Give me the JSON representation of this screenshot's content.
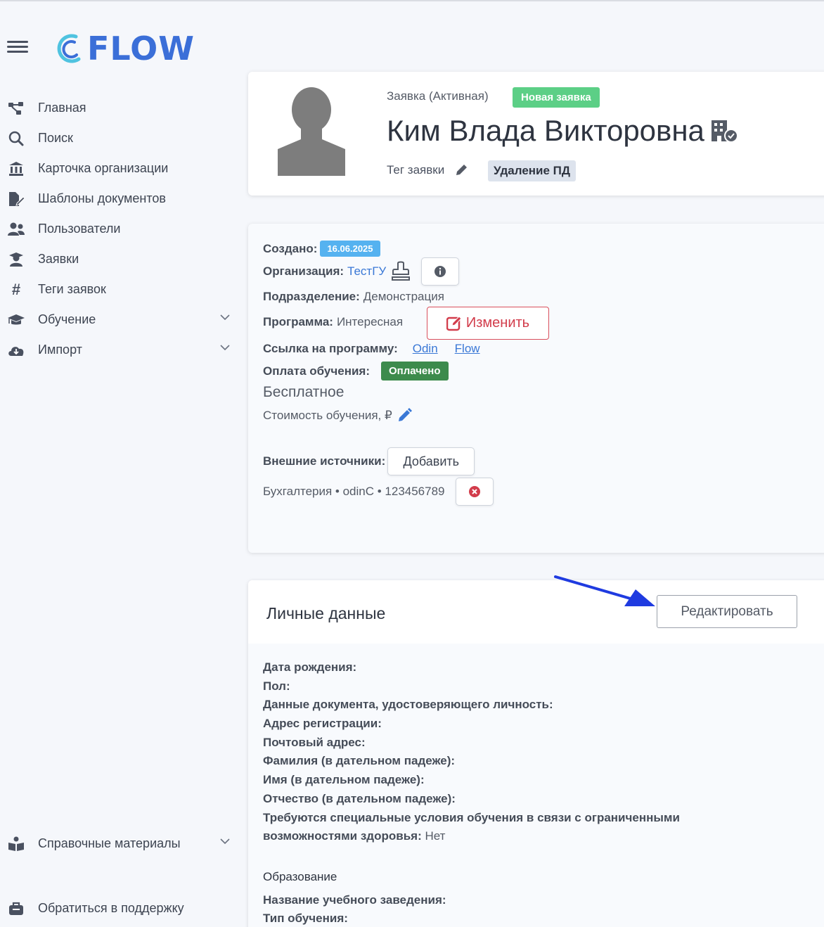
{
  "brand": {
    "name": "FLOW"
  },
  "sidebar": {
    "items": [
      {
        "label": "Главная",
        "icon": "share-nodes-icon"
      },
      {
        "label": "Поиск",
        "icon": "search-icon"
      },
      {
        "label": "Карточка организации",
        "icon": "bank-icon"
      },
      {
        "label": "Шаблоны документов",
        "icon": "file-edit-icon"
      },
      {
        "label": "Пользователи",
        "icon": "users-icon"
      },
      {
        "label": "Заявки",
        "icon": "user-graduate-icon"
      },
      {
        "label": "Теги заявок",
        "icon": "hashtag-icon"
      },
      {
        "label": "Обучение",
        "icon": "graduation-cap-icon"
      },
      {
        "label": "Импорт",
        "icon": "cloud-download-icon"
      }
    ],
    "bottom_items": [
      {
        "label": "Справочные материалы",
        "icon": "book-reader-icon"
      },
      {
        "label": "Обратиться в поддержку",
        "icon": "support-briefcase-icon"
      }
    ]
  },
  "profile": {
    "status": "Заявка (Активная)",
    "badge": "Новая заявка",
    "name": "Ким Влада Викторовна",
    "tag_label": "Тег заявки",
    "tag_value": "Удаление ПД"
  },
  "info": {
    "created_label": "Создано:",
    "created_date": "16.06.2025",
    "org_label": "Организация:",
    "org_value": "ТестГУ",
    "dept_label": "Подразделение:",
    "dept_value": "Демонстрация",
    "program_label": "Программа:",
    "program_value": "Интересная",
    "change_button": "Изменить",
    "link_label": "Ссылка на программу:",
    "link_1": "Odin",
    "link_2": "Flow",
    "payment_label": "Оплата обучения:",
    "payment_status": "Оплачено",
    "free_label": "Бесплатное",
    "cost_label": "Стоимость обучения, ₽",
    "sources_label": "Внешние источники:",
    "add_button": "Добавить",
    "source_entry": "Бухгалтерия • odinC • 123456789"
  },
  "personal": {
    "title": "Личные данные",
    "edit_button": "Редактировать",
    "fields": [
      {
        "label": "Дата рождения:",
        "value": ""
      },
      {
        "label": "Пол:",
        "value": ""
      },
      {
        "label": "Данные документа, удостоверяющего личность:",
        "value": ""
      },
      {
        "label": "Адрес регистрации:",
        "value": ""
      },
      {
        "label": "Почтовый адрес:",
        "value": ""
      },
      {
        "label": "Фамилия (в дательном падеже):",
        "value": ""
      },
      {
        "label": "Имя (в дательном падеже):",
        "value": ""
      },
      {
        "label": "Отчество (в дательном падеже):",
        "value": ""
      }
    ],
    "special_label_1": "Требуются специальные условия обучения в связи с ограниченными",
    "special_label_2": "возможностями здоровья:",
    "special_value": "Нет",
    "education_heading": "Образование",
    "edu_fields": [
      {
        "label": "Название учебного заведения:"
      },
      {
        "label": "Тип обучения:"
      }
    ]
  },
  "colors": {
    "accent": "#3b6fd8",
    "new_badge": "#5ccf86",
    "date_badge": "#55b2f0",
    "paid_badge": "#3d8b4c",
    "danger": "#d23c4b",
    "annotation_arrow": "#1f3be0"
  }
}
